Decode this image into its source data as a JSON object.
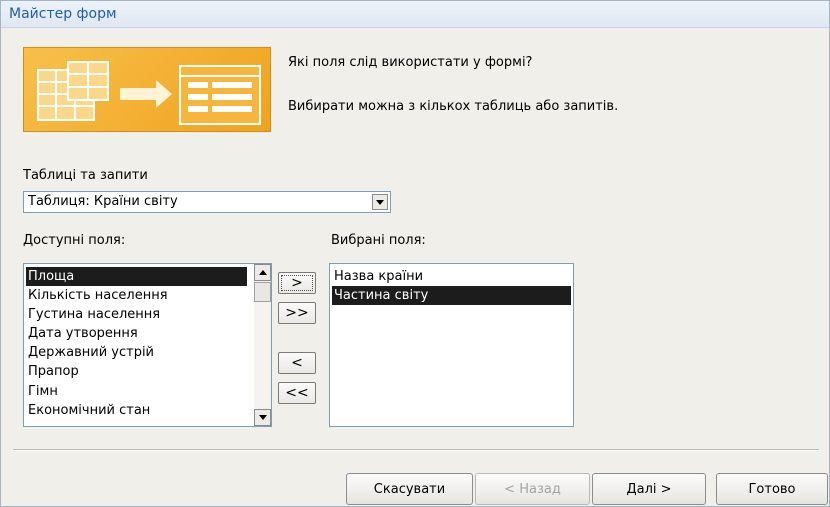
{
  "window": {
    "title": "Майстер форм"
  },
  "intro": {
    "question": "Які поля слід використати у формі?",
    "hint": "Вибирати можна з кількох таблиць або запитів."
  },
  "tables": {
    "label": "Таблиці та запити",
    "selected": "Таблиця: Країни світу"
  },
  "available": {
    "label": "Доступні поля:",
    "items": [
      {
        "text": "Площа",
        "selected": true
      },
      {
        "text": "Кількість населення",
        "selected": false
      },
      {
        "text": "Густина населення",
        "selected": false
      },
      {
        "text": "Дата утворення",
        "selected": false
      },
      {
        "text": "Державний устрій",
        "selected": false
      },
      {
        "text": "Прапор",
        "selected": false
      },
      {
        "text": "Гімн",
        "selected": false
      },
      {
        "text": "Економічний стан",
        "selected": false
      }
    ]
  },
  "chosen": {
    "label": "Вибрані поля:",
    "items": [
      {
        "text": "Назва країни",
        "selected": false
      },
      {
        "text": "Частина світу",
        "selected": true
      }
    ]
  },
  "move_buttons": {
    "add": ">",
    "add_all": ">>",
    "remove": "<",
    "remove_all": "<<"
  },
  "footer": {
    "cancel": "Скасувати",
    "back": "< Назад",
    "next": "Далі >",
    "finish": "Готово"
  },
  "colors": {
    "title": "#1f5fa8",
    "banner": "#f0a21e",
    "selection": "#1c1c1c"
  },
  "icons": [
    "table-to-form-illustration",
    "dropdown-arrow-icon",
    "scroll-up-icon",
    "scroll-down-icon"
  ]
}
